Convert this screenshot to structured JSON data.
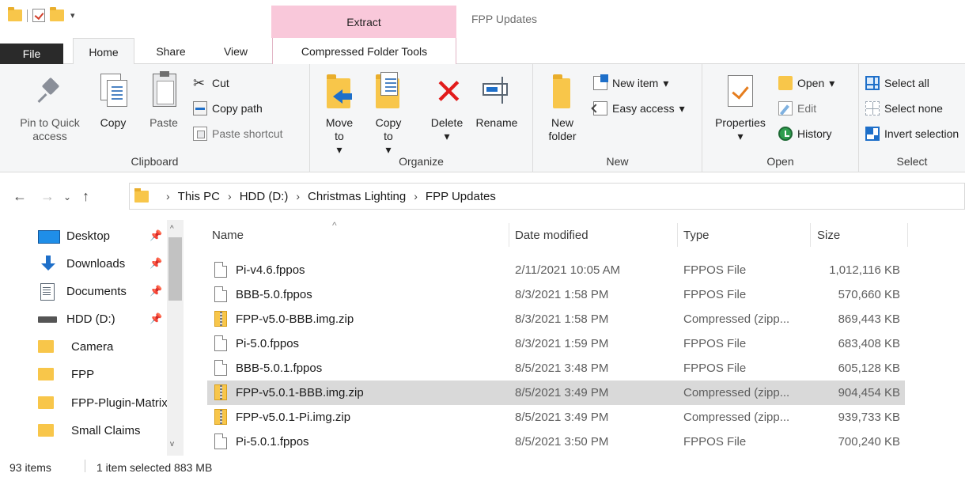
{
  "window": {
    "title": "FPP Updates",
    "context_tab": "Extract"
  },
  "tabs": {
    "file": "File",
    "home": "Home",
    "share": "Share",
    "view": "View",
    "compressed": "Compressed Folder Tools"
  },
  "ribbon": {
    "clipboard": {
      "label": "Clipboard",
      "pin": "Pin to Quick access",
      "copy": "Copy",
      "paste": "Paste",
      "cut": "Cut",
      "copy_path": "Copy path",
      "paste_shortcut": "Paste shortcut"
    },
    "organize": {
      "label": "Organize",
      "move_to": "Move to",
      "copy_to": "Copy to",
      "delete": "Delete",
      "rename": "Rename"
    },
    "new": {
      "label": "New",
      "new_folder": "New folder",
      "new_item": "New item",
      "easy_access": "Easy access"
    },
    "open": {
      "label": "Open",
      "properties": "Properties",
      "open": "Open",
      "edit": "Edit",
      "history": "History"
    },
    "select": {
      "label": "Select",
      "select_all": "Select all",
      "select_none": "Select none",
      "invert": "Invert selection"
    }
  },
  "address": {
    "crumbs": [
      "This PC",
      "HDD (D:)",
      "Christmas Lighting",
      "FPP Updates"
    ]
  },
  "nav": {
    "items": [
      {
        "label": "Desktop",
        "icon": "desktop-icon",
        "pinned": true
      },
      {
        "label": "Downloads",
        "icon": "downloads-icon",
        "pinned": true
      },
      {
        "label": "Documents",
        "icon": "documents-icon",
        "pinned": true
      },
      {
        "label": "HDD (D:)",
        "icon": "drive-icon",
        "pinned": true
      },
      {
        "label": "Camera",
        "icon": "folder-icon",
        "pinned": false
      },
      {
        "label": "FPP",
        "icon": "folder-icon",
        "pinned": false
      },
      {
        "label": "FPP-Plugin-Matrix",
        "icon": "folder-icon",
        "pinned": false
      },
      {
        "label": "Small Claims",
        "icon": "folder-icon",
        "pinned": false
      }
    ]
  },
  "columns": {
    "name": "Name",
    "date": "Date modified",
    "type": "Type",
    "size": "Size"
  },
  "files": [
    {
      "name": "Pi-v4.6.fppos",
      "date": "2/11/2021 10:05 AM",
      "type": "FPPOS File",
      "size": "1,012,116 KB",
      "kind": "file",
      "selected": false
    },
    {
      "name": "BBB-5.0.fppos",
      "date": "8/3/2021 1:58 PM",
      "type": "FPPOS File",
      "size": "570,660 KB",
      "kind": "file",
      "selected": false
    },
    {
      "name": "FPP-v5.0-BBB.img.zip",
      "date": "8/3/2021 1:58 PM",
      "type": "Compressed (zipp...",
      "size": "869,443 KB",
      "kind": "zip",
      "selected": false
    },
    {
      "name": "Pi-5.0.fppos",
      "date": "8/3/2021 1:59 PM",
      "type": "FPPOS File",
      "size": "683,408 KB",
      "kind": "file",
      "selected": false
    },
    {
      "name": "BBB-5.0.1.fppos",
      "date": "8/5/2021 3:48 PM",
      "type": "FPPOS File",
      "size": "605,128 KB",
      "kind": "file",
      "selected": false
    },
    {
      "name": "FPP-v5.0.1-BBB.img.zip",
      "date": "8/5/2021 3:49 PM",
      "type": "Compressed (zipp...",
      "size": "904,454 KB",
      "kind": "zip",
      "selected": true
    },
    {
      "name": "FPP-v5.0.1-Pi.img.zip",
      "date": "8/5/2021 3:49 PM",
      "type": "Compressed (zipp...",
      "size": "939,733 KB",
      "kind": "zip",
      "selected": false
    },
    {
      "name": "Pi-5.0.1.fppos",
      "date": "8/5/2021 3:50 PM",
      "type": "FPPOS File",
      "size": "700,240 KB",
      "kind": "file",
      "selected": false
    }
  ],
  "status": {
    "count": "93 items",
    "selection": "1 item selected 883 MB"
  },
  "glyphs": {
    "back": "←",
    "forward": "→",
    "recent": "⌄",
    "up": "↑",
    "chevron": "›",
    "dropdown": "▾",
    "pin": "📌",
    "sort": "^",
    "scroll_up": "^",
    "scroll_down": "v",
    "cut": "✂",
    "delete": "✕"
  }
}
